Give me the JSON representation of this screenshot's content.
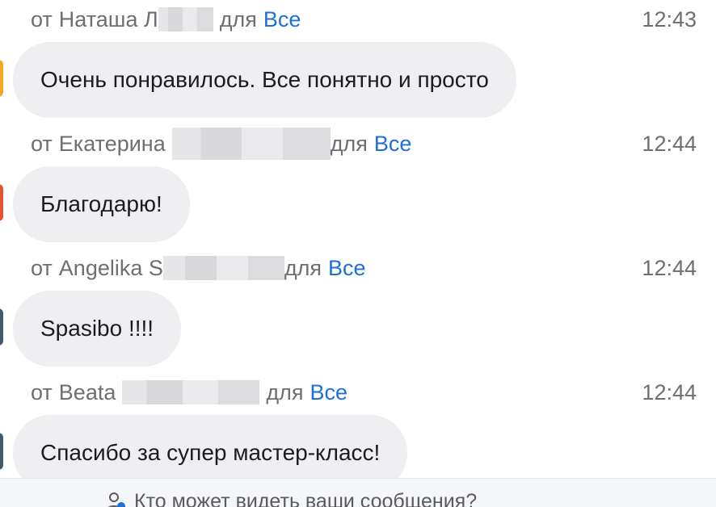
{
  "messages": [
    {
      "from_prefix": "от",
      "sender": "Наташа Л",
      "to_prefix": "для",
      "to": "Все",
      "time": "12:43",
      "text": "Очень понравилось. Все понятно и просто",
      "avatar_color": "#f5a623"
    },
    {
      "from_prefix": "от",
      "sender": "Екатерина",
      "to_prefix": "для",
      "to": "Все",
      "time": "12:44",
      "text": "Благодарю!",
      "avatar_color": "#e8532f"
    },
    {
      "from_prefix": "от",
      "sender": "Angelika S",
      "to_prefix": "для",
      "to": "Все",
      "time": "12:44",
      "text": "Spasibo !!!!",
      "avatar_color": "#3d5a6e"
    },
    {
      "from_prefix": "от",
      "sender": "Beata",
      "to_prefix": "для",
      "to": "Все",
      "time": "12:44",
      "text": "Спасибо за супер мастер-класс!",
      "avatar_color": "#3d5a6e"
    }
  ],
  "footer": {
    "text": "Кто может видеть ваши сообщения?",
    "icon": "person-privacy-icon"
  },
  "colors": {
    "accent": "#1f6fd9",
    "bubble": "#efeff2",
    "meta_text": "#6e6e73"
  }
}
